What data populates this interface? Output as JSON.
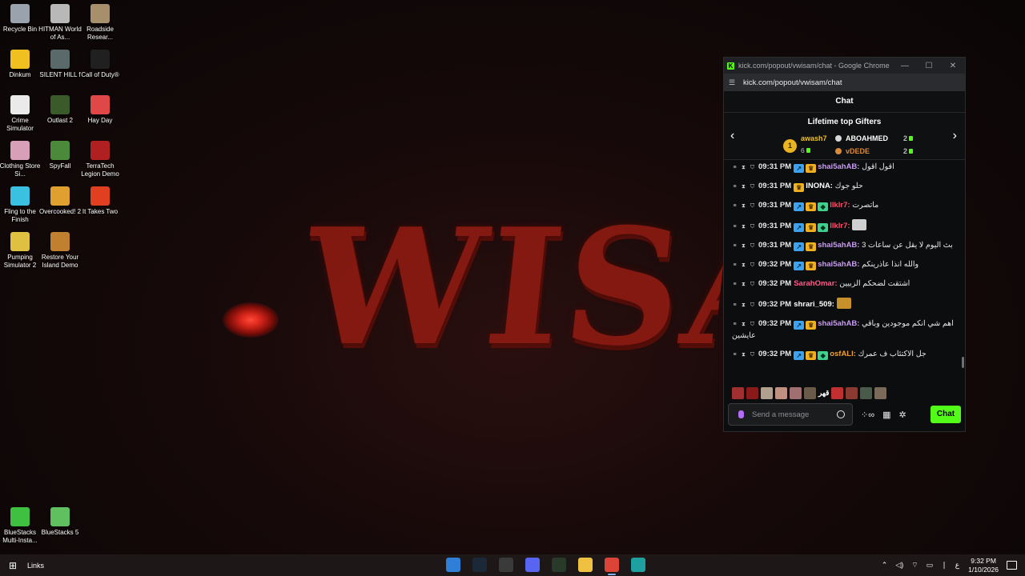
{
  "wallpaper": {
    "title": "WISAM"
  },
  "desktop_icons": [
    {
      "label": "Recycle Bin",
      "color": "#9aa3ad"
    },
    {
      "label": "HITMAN World of As...",
      "color": "#b8b8b8"
    },
    {
      "label": "Roadside Resear...",
      "color": "#a88f6b"
    },
    {
      "label": "Dinkum",
      "color": "#f0c020"
    },
    {
      "label": "SILENT HILL f",
      "color": "#5a6a6a"
    },
    {
      "label": "Call of Duty®",
      "color": "#202020"
    },
    {
      "label": "Crime Simulator",
      "color": "#eaeaea"
    },
    {
      "label": "Outlast 2",
      "color": "#3a5a2a"
    },
    {
      "label": "Hay Day",
      "color": "#e04848"
    },
    {
      "label": "Clothing Store Si...",
      "color": "#d8a0b8"
    },
    {
      "label": "SpyFall",
      "color": "#4a8a3a"
    },
    {
      "label": "TerraTech Legion Demo",
      "color": "#b02020"
    },
    {
      "label": "Fling to the Finish",
      "color": "#3ac0e0"
    },
    {
      "label": "Overcooked! 2",
      "color": "#e0a030"
    },
    {
      "label": "It Takes Two",
      "color": "#e04020"
    },
    {
      "label": "Pumping Simulator 2",
      "color": "#e0c040"
    },
    {
      "label": "Restore Your Island Demo",
      "color": "#c08030"
    },
    {
      "label": "BlueStacks Multi-Insta...",
      "color": "#40c040"
    },
    {
      "label": "BlueStacks 5",
      "color": "#60c060"
    }
  ],
  "browser": {
    "title": "kick.com/popout/vwisam/chat - Google Chrome",
    "url": "kick.com/popout/vwisam/chat",
    "minimize_glyph": "—",
    "maximize_glyph": "☐",
    "close_glyph": "✕"
  },
  "chat": {
    "header": "Chat",
    "gifters_title": "Lifetime top Gifters",
    "top_gifter": {
      "rank": "1",
      "name": "awash7",
      "count": "6"
    },
    "gifters": [
      {
        "name": "ABOAHMED",
        "count": "2",
        "color": "#d8d8d8"
      },
      {
        "name": "vDEDE",
        "count": "2",
        "color": "#d98a3a"
      }
    ],
    "messages": [
      {
        "time": "09:31 PM",
        "user": "shai5ahAB:",
        "color": "#c89cf0",
        "text": "اقول اقول",
        "badges": [
          "blue",
          "crown"
        ]
      },
      {
        "time": "09:31 PM",
        "user": "INONA:",
        "color": "#ffffff",
        "text": "حلو جوك",
        "badges": [
          "crown"
        ]
      },
      {
        "time": "09:31 PM",
        "user": "llklr7:",
        "color": "#ff4d6d",
        "text": "ماتصرت",
        "badges": [
          "blue",
          "crown",
          "green"
        ]
      },
      {
        "time": "09:31 PM",
        "user": "llklr7:",
        "color": "#ff4d6d",
        "text": "",
        "badges": [
          "blue",
          "crown",
          "green"
        ],
        "emote": true
      },
      {
        "time": "09:31 PM",
        "user": "shai5ahAB:",
        "color": "#c89cf0",
        "text": "3 بث اليوم لا يقل عن ساعات",
        "badges": [
          "blue",
          "crown"
        ],
        "wrap": true
      },
      {
        "time": "09:32 PM",
        "user": "shai5ahAB:",
        "color": "#c89cf0",
        "text": "والله انذا عاذرينكم",
        "badges": [
          "blue",
          "crown"
        ]
      },
      {
        "time": "09:32 PM",
        "user": "SarahOmar:",
        "color": "#ff5a8a",
        "text": "اشتقت لضحكم الزبيين",
        "badges": []
      },
      {
        "time": "09:32 PM",
        "user": "shrari_509:",
        "color": "#ffffff",
        "text": "",
        "badges": [],
        "emote": true
      },
      {
        "time": "09:32 PM",
        "user": "shai5ahAB:",
        "color": "#c89cf0",
        "text": "اهم شي انكم موجودين وباقي عايشين",
        "badges": [
          "blue",
          "crown"
        ],
        "wrap": true
      },
      {
        "time": "09:32 PM",
        "user": "osfALI:",
        "color": "#f0a030",
        "text": "جل الاكتئاب ف عمرك",
        "badges": [
          "blue",
          "crown",
          "green"
        ]
      }
    ],
    "emote_strip_text": "قهر",
    "input_placeholder": "Send a message",
    "send_label": "Chat"
  },
  "taskbar": {
    "links_label": "Links",
    "apps": [
      {
        "name": "outlook-icon",
        "color": "#2f7fd8"
      },
      {
        "name": "steam-icon",
        "color": "#1b2838"
      },
      {
        "name": "overwolf-icon",
        "color": "#3a3a3a"
      },
      {
        "name": "discord-icon",
        "color": "#5865f2"
      },
      {
        "name": "xbox-icon",
        "color": "#2a3a2a"
      },
      {
        "name": "file-explorer-icon",
        "color": "#f0c040"
      },
      {
        "name": "chrome-icon",
        "color": "#db4437"
      },
      {
        "name": "edge-icon",
        "color": "#1fa0a0"
      }
    ],
    "language": "ع",
    "time": "9:32 PM",
    "date": "1/10/2026"
  }
}
